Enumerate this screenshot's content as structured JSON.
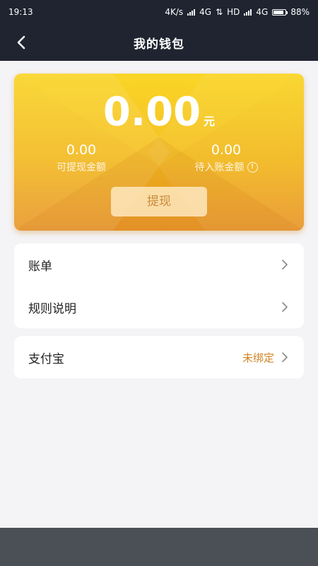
{
  "status_bar": {
    "time": "19:13",
    "network_speed": "4K/s",
    "sim1": "4G",
    "hd": "HD",
    "sim2": "4G",
    "battery": "88%",
    "battery_level": 0.88
  },
  "nav": {
    "title": "我的钱包"
  },
  "wallet": {
    "balance": "0.00",
    "balance_unit": "元",
    "withdrawable_amount": "0.00",
    "withdrawable_label": "可提现金额",
    "pending_amount": "0.00",
    "pending_label": "待入账金额",
    "withdraw_button": "提现"
  },
  "menu": {
    "items": [
      {
        "label": "账单"
      },
      {
        "label": "规则说明"
      }
    ]
  },
  "alipay": {
    "label": "支付宝",
    "status": "未绑定"
  },
  "colors": {
    "header_bg": "#1f2430",
    "card_top": "#f9d423",
    "card_bottom": "#e8962a",
    "accent_status": "#d18424",
    "page_bg": "#f4f3f5"
  }
}
